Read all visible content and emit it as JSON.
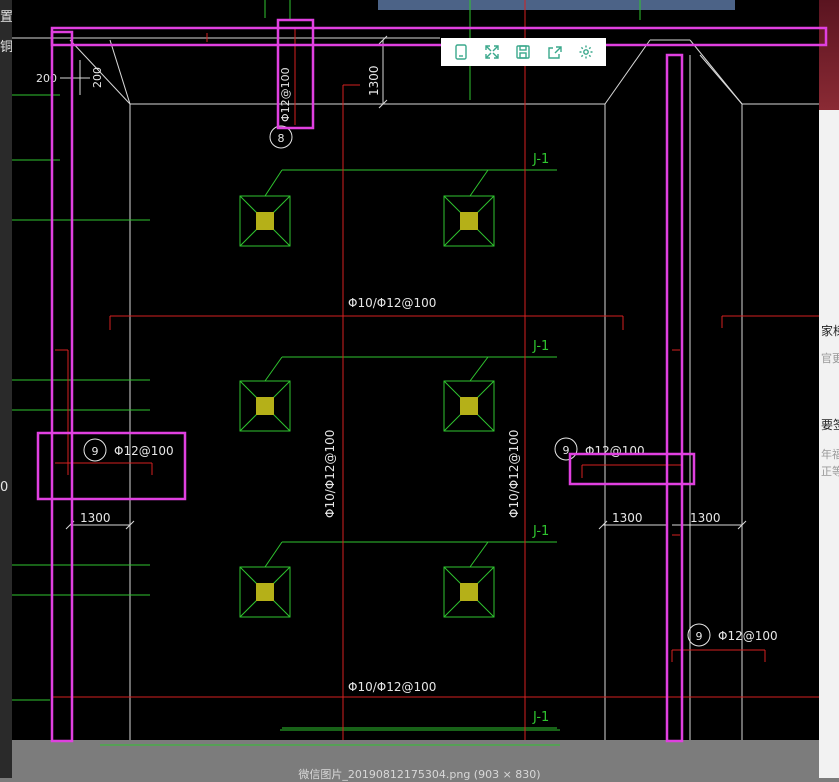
{
  "sidebar_left": {
    "t1": "置",
    "t2": "铜",
    "t3": "0"
  },
  "right_panel": {
    "t1": "家様",
    "t2": "官更",
    "t3": "要签",
    "t4": "年福",
    "t5": "正等"
  },
  "toolbar": {
    "icons": [
      "tablet-icon",
      "fullscreen-icon",
      "save-icon",
      "share-icon",
      "settings-icon"
    ]
  },
  "caption": "微信图片_20190812175304.png (903 × 830)",
  "drawing": {
    "dim_200_a": "200",
    "dim_200_b": "200",
    "dim_1300_top": "1300",
    "rebar_top": "Φ12@100",
    "circle_8": "8",
    "circle_9_left": "9",
    "rebar_left": "Φ12@100",
    "circle_9_mid": "9",
    "rebar_mid": "Φ12@100",
    "circle_9_right": "9",
    "rebar_right": "Φ12@100",
    "dim_1300_left": "1300",
    "dim_1300_mid": "1300",
    "dim_1300_right": "1300",
    "label_j1": "J-1",
    "mesh_1": "Φ10/Φ12@100",
    "mesh_2": "Φ10/Φ12@100",
    "mesh_v1": "Φ10/Φ12@100",
    "mesh_v2": "Φ10/Φ12@100"
  }
}
